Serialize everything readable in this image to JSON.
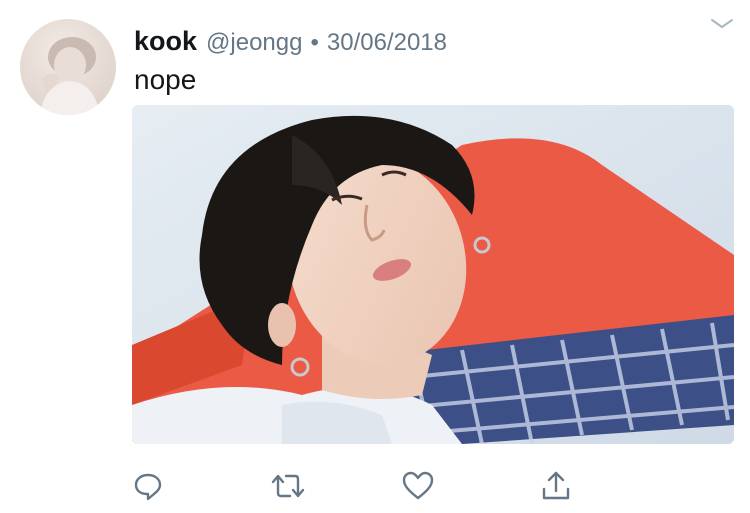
{
  "tweet": {
    "display_name": "kook",
    "handle": "@jeongg",
    "separator": "•",
    "date": "30/06/2018",
    "text": "nope"
  },
  "colors": {
    "primary_text": "#14171a",
    "secondary_text": "#657786",
    "icon": "#657786"
  },
  "icons": {
    "caret": "chevron-down-icon",
    "reply": "reply-icon",
    "retweet": "retweet-icon",
    "like": "heart-icon",
    "share": "share-icon"
  }
}
